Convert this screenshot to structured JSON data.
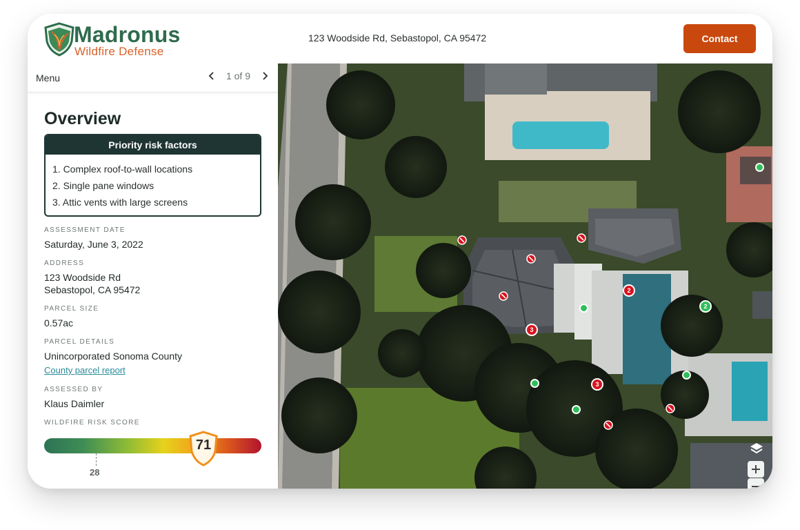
{
  "brand": {
    "name": "Madronus",
    "tagline": "Wildfire Defense"
  },
  "header": {
    "address": "123 Woodside Rd, Sebastopol, CA 95472",
    "contact_label": "Contact"
  },
  "menu": {
    "label": "Menu",
    "pager": "1 of 9"
  },
  "overview": {
    "title": "Overview",
    "priority_title": "Priority risk factors",
    "priority_items": [
      "1. Complex roof-to-wall locations",
      "2. Single pane windows",
      "3. Attic vents with large screens"
    ]
  },
  "details": {
    "assessment_date_label": "ASSESSMENT DATE",
    "assessment_date": "Saturday, June 3, 2022",
    "address_label": "ADDRESS",
    "address_line1": "123 Woodside Rd",
    "address_line2": "Sebastopol, CA 95472",
    "parcel_size_label": "PARCEL SIZE",
    "parcel_size": "0.57ac",
    "parcel_details_label": "PARCEL DETAILS",
    "parcel_details": "Unincorporated Sonoma County",
    "parcel_link": "County parcel report",
    "assessed_by_label": "ASSESSED BY",
    "assessed_by": "Klaus Daimler",
    "risk_score_label": "WILDFIRE RISK SCORE"
  },
  "risk_score": {
    "value": "71",
    "reference": "28",
    "scale_max": 100
  },
  "map": {
    "markers_red_numbers": [
      "2",
      "3",
      "3"
    ],
    "markers_green_numbers": [
      "2"
    ]
  },
  "colors": {
    "brand_green": "#2e6b4c",
    "brand_orange": "#d9612a",
    "contact_button": "#c9480e",
    "panel_dark": "#1f3533",
    "marker_red": "#d7141f",
    "marker_green": "#2fbf5a"
  },
  "icons": {
    "logo": "madrone-leaf-shield-icon",
    "prev": "chevron-left-icon",
    "next": "chevron-right-icon",
    "layers": "layers-icon",
    "zoom_in": "plus-icon",
    "zoom_out": "minus-icon",
    "score_badge": "shield-badge-icon"
  }
}
